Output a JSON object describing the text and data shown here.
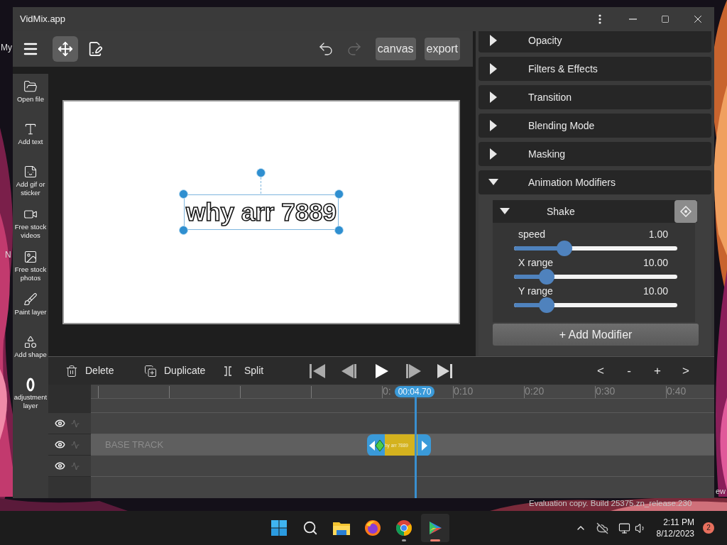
{
  "desktop": {
    "icon_labels": [
      "My",
      "N",
      "ew"
    ],
    "watermark": "Evaluation copy. Build 25375.zn_release.230"
  },
  "window": {
    "title": "VidMix.app"
  },
  "toolbar": {
    "tools": [
      {
        "kind": "move",
        "selected": true
      },
      {
        "kind": "edit",
        "selected": false
      }
    ],
    "undo": {
      "disabled": false
    },
    "redo": {
      "disabled": true
    },
    "buttons": [
      "canvas",
      "export"
    ]
  },
  "sidebar": {
    "items": [
      {
        "kind": "folder",
        "label": "Open file"
      },
      {
        "kind": "text",
        "label": "Add text"
      },
      {
        "kind": "sticker",
        "label": "Add gif or sticker"
      },
      {
        "kind": "video",
        "label": "Free stock videos"
      },
      {
        "label": "Free stock photos"
      },
      {
        "kind": "brush",
        "label": "Paint layer"
      },
      {
        "kind": "shape",
        "label": "Add shape"
      },
      {
        "kind": "adjustment",
        "label": "adjustment layer"
      }
    ]
  },
  "canvas": {
    "text": "why arr 7889",
    "selected": true
  },
  "properties": {
    "sections": [
      {
        "label": "Opacity",
        "expanded": false
      },
      {
        "label": "Filters & Effects",
        "expanded": false
      },
      {
        "label": "Transition",
        "expanded": false
      },
      {
        "label": "Blending Mode",
        "expanded": false
      },
      {
        "label": "Masking",
        "expanded": false
      },
      {
        "label": "Animation Modifiers",
        "expanded": true
      }
    ],
    "modifier": {
      "name": "Shake",
      "expanded": true,
      "params": [
        {
          "label": "speed",
          "value": "1.00",
          "level": 0.31
        },
        {
          "label": "X range",
          "value": "10.00",
          "level": 0.2
        },
        {
          "label": "Y range",
          "value": "10.00",
          "level": 0.2
        }
      ]
    },
    "add_button": "+ Add Modifier"
  },
  "timeline": {
    "actions": [
      {
        "kind": "delete",
        "label": "Delete"
      },
      {
        "kind": "duplicate",
        "label": "Duplicate"
      },
      {
        "kind": "split",
        "label": "Split"
      }
    ],
    "transport": [
      {
        "kind": "first"
      },
      {
        "kind": "prev"
      },
      {
        "kind": "play"
      },
      {
        "kind": "next"
      },
      {
        "kind": "last"
      }
    ],
    "zoom_controls": [
      "<",
      "-",
      "+",
      ">"
    ],
    "ruler_labels": [
      "0:",
      "0:10",
      "0:20",
      "0:30",
      "0:40"
    ],
    "playhead": "00:04.70",
    "tracks": [
      {
        "selected": false
      },
      {
        "selected": true,
        "label": "BASE TRACK",
        "clip": {
          "label": "hy arr 7889"
        }
      },
      {
        "selected": false
      }
    ]
  },
  "taskbar": {
    "apps": [
      {
        "kind": "start",
        "running": false,
        "active": false
      },
      {
        "kind": "search",
        "running": false,
        "active": false
      },
      {
        "kind": "folder",
        "running": false,
        "active": false
      },
      {
        "kind": "fox",
        "running": false,
        "active": false
      },
      {
        "kind": "chrome",
        "running": true,
        "active": false
      },
      {
        "kind": "play",
        "running": true,
        "active": true
      }
    ],
    "time": "2:11 PM",
    "date": "8/12/2023",
    "notifications": "2"
  }
}
